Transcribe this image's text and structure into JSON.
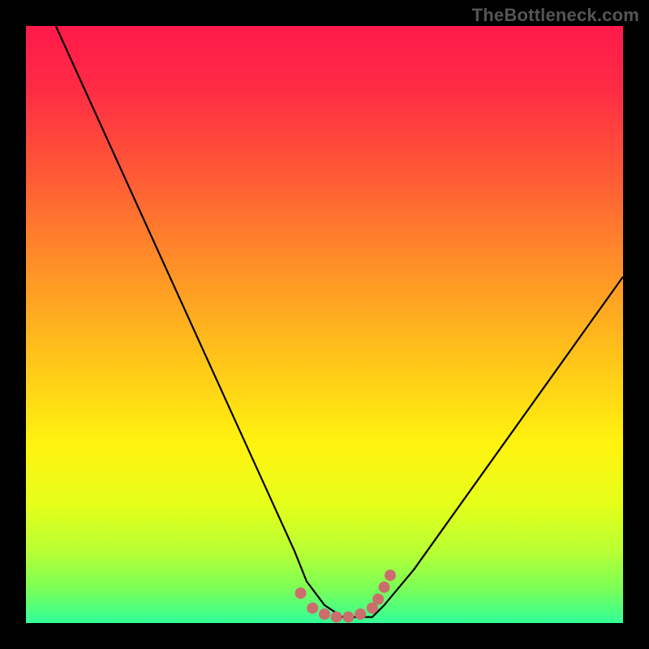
{
  "watermark": "TheBottleneck.com",
  "colors": {
    "bg": "#000000",
    "gradient_stops": [
      {
        "offset": 0.0,
        "color": "#ff1a4b"
      },
      {
        "offset": 0.1,
        "color": "#ff2a45"
      },
      {
        "offset": 0.25,
        "color": "#ff5a36"
      },
      {
        "offset": 0.4,
        "color": "#ff8f28"
      },
      {
        "offset": 0.55,
        "color": "#ffc21a"
      },
      {
        "offset": 0.7,
        "color": "#fff30f"
      },
      {
        "offset": 0.8,
        "color": "#e6ff1a"
      },
      {
        "offset": 0.88,
        "color": "#b8ff33"
      },
      {
        "offset": 0.94,
        "color": "#7dff55"
      },
      {
        "offset": 1.0,
        "color": "#33ff99"
      }
    ],
    "curve": "#000000",
    "marker": "#cc6d6d"
  },
  "chart_data": {
    "type": "line",
    "title": "",
    "xlabel": "",
    "ylabel": "",
    "xlim": [
      0,
      100
    ],
    "ylim": [
      0,
      100
    ],
    "grid": false,
    "legend": false,
    "series": [
      {
        "name": "bottleneck-curve",
        "x": [
          5,
          10,
          15,
          20,
          25,
          30,
          35,
          40,
          45,
          47,
          50,
          53,
          55,
          58,
          60,
          65,
          70,
          75,
          80,
          85,
          90,
          95,
          100
        ],
        "y": [
          100,
          89,
          78,
          67,
          56,
          45,
          34,
          23,
          12,
          7,
          3,
          1,
          1,
          1,
          3,
          9,
          16,
          23,
          30,
          37,
          44,
          51,
          58
        ]
      }
    ],
    "markers": {
      "name": "highlight-dots",
      "x": [
        46,
        48,
        50,
        52,
        54,
        56,
        58,
        59,
        60,
        61
      ],
      "y": [
        5,
        2.5,
        1.5,
        1,
        1,
        1.5,
        2.5,
        4,
        6,
        8
      ]
    }
  }
}
